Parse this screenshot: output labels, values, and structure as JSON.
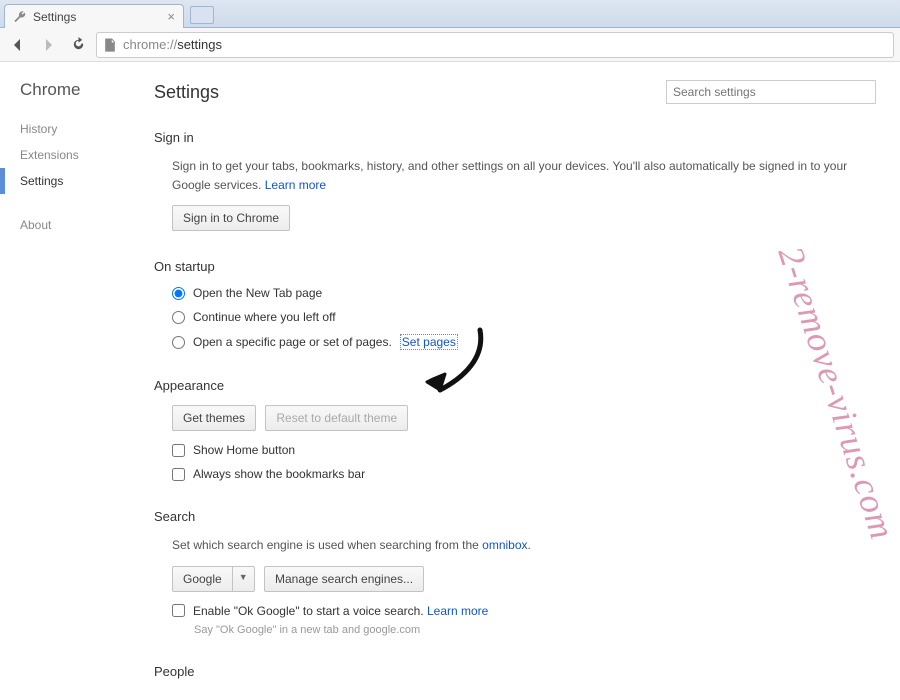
{
  "tab": {
    "title": "Settings"
  },
  "url": {
    "scheme": "chrome://",
    "path": "settings"
  },
  "sidebar": {
    "brand": "Chrome",
    "items": [
      "History",
      "Extensions",
      "Settings"
    ],
    "about": "About"
  },
  "header": {
    "title": "Settings",
    "search_placeholder": "Search settings"
  },
  "signin": {
    "heading": "Sign in",
    "desc1": "Sign in to get your tabs, bookmarks, history, and other settings on all your devices. You'll also automatically be signed in to your Google services. ",
    "learn": "Learn more",
    "button": "Sign in to Chrome"
  },
  "startup": {
    "heading": "On startup",
    "opt1": "Open the New Tab page",
    "opt2": "Continue where you left off",
    "opt3": "Open a specific page or set of pages. ",
    "set_pages": "Set pages"
  },
  "appearance": {
    "heading": "Appearance",
    "get_themes": "Get themes",
    "reset_theme": "Reset to default theme",
    "show_home": "Show Home button",
    "show_bookmarks": "Always show the bookmarks bar"
  },
  "search": {
    "heading": "Search",
    "desc": "Set which search engine is used when searching from the ",
    "omnibox_link": "omnibox",
    "engine": "Google",
    "manage": "Manage search engines...",
    "ok_google": "Enable \"Ok Google\" to start a voice search. ",
    "learn": "Learn more",
    "hint": "Say \"Ok Google\" in a new tab and google.com"
  },
  "people": {
    "heading": "People"
  },
  "watermark": "2-remove-virus.com"
}
